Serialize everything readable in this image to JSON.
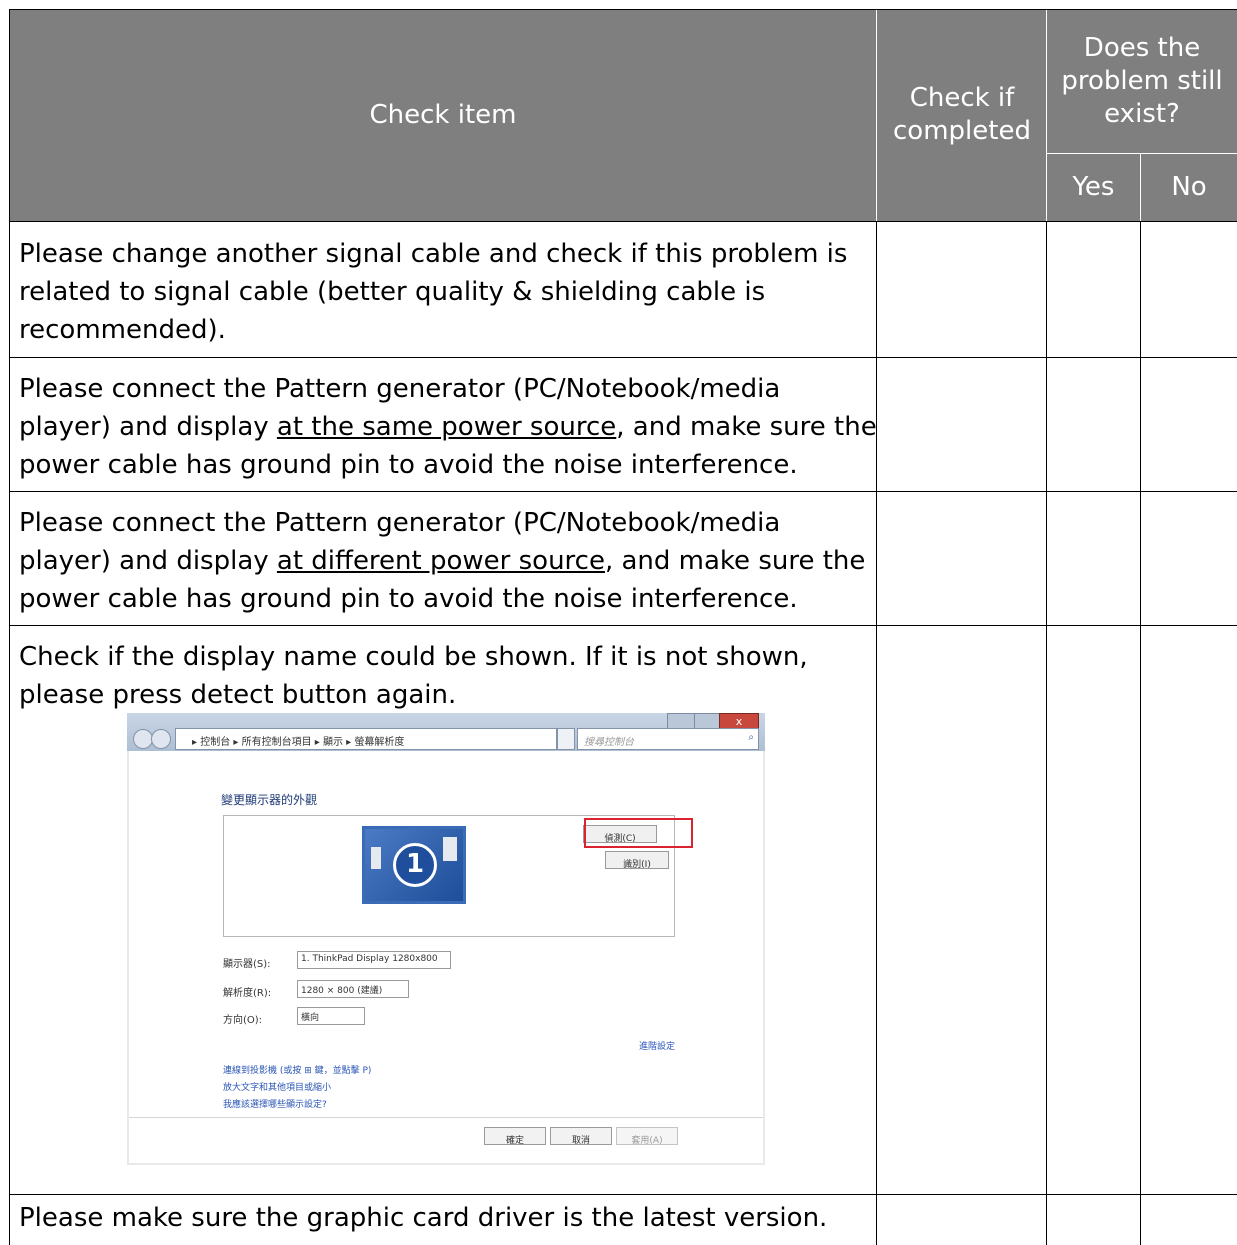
{
  "header": {
    "check_item": "Check item",
    "check_if_completed": [
      "Check if",
      "completed"
    ],
    "problem_still_exist": [
      "Does the",
      "problem still",
      "exist?"
    ],
    "yes": "Yes",
    "no": "No"
  },
  "rows": [
    {
      "lines": [
        "Please change another signal cable and check if this problem is",
        "related to signal cable (better quality & shielding cable is",
        "recommended)."
      ]
    },
    {
      "line1": "Please connect the Pattern generator (PC/Notebook/media",
      "line2_pre": "player) and display ",
      "line2_link": "at the same power source",
      "line2_post": ", and make sure the",
      "line3": "power cable has ground pin to avoid the noise interference."
    },
    {
      "line1": "Please connect the Pattern generator (PC/Notebook/media",
      "line2_pre": "player) and display ",
      "line2_link": "at different power source",
      "line2_post": ", and make sure the",
      "line3": "power cable has ground pin to avoid the noise interference."
    },
    {
      "lines": [
        "Check if the display name could be shown. If it is not shown,",
        "please press detect button again."
      ],
      "screenshot": {
        "breadcrumb": "▸ 控制台 ▸ 所有控制台項目 ▸ 顯示 ▸ 螢幕解析度",
        "search_placeholder": "搜尋控制台",
        "title": "變更顯示器的外觀",
        "monitor_number": "1",
        "detect_button": "偵測(C)",
        "identify_button": "識別(I)",
        "display_label": "顯示器(S):",
        "display_value": "1. ThinkPad Display 1280x800",
        "resolution_label": "解析度(R):",
        "resolution_value": "1280 × 800 (建議)",
        "orientation_label": "方向(O):",
        "orientation_value": "橫向",
        "advanced_link": "進階設定",
        "link1": "連線到投影機 (或按 ⊞ 鍵，並點擊 P)",
        "link2": "放大文字和其他項目或縮小",
        "link3": "我應該選擇哪些顯示設定?",
        "ok_button": "確定",
        "cancel_button": "取消",
        "apply_button": "套用(A)",
        "highlight_color": "#d9232e"
      }
    },
    {
      "lines": [
        "Please make sure the graphic card driver is the latest version."
      ]
    }
  ],
  "colors": {
    "header_bg": "#7f7f7f",
    "header_text": "#ffffff",
    "border": "#000000"
  }
}
